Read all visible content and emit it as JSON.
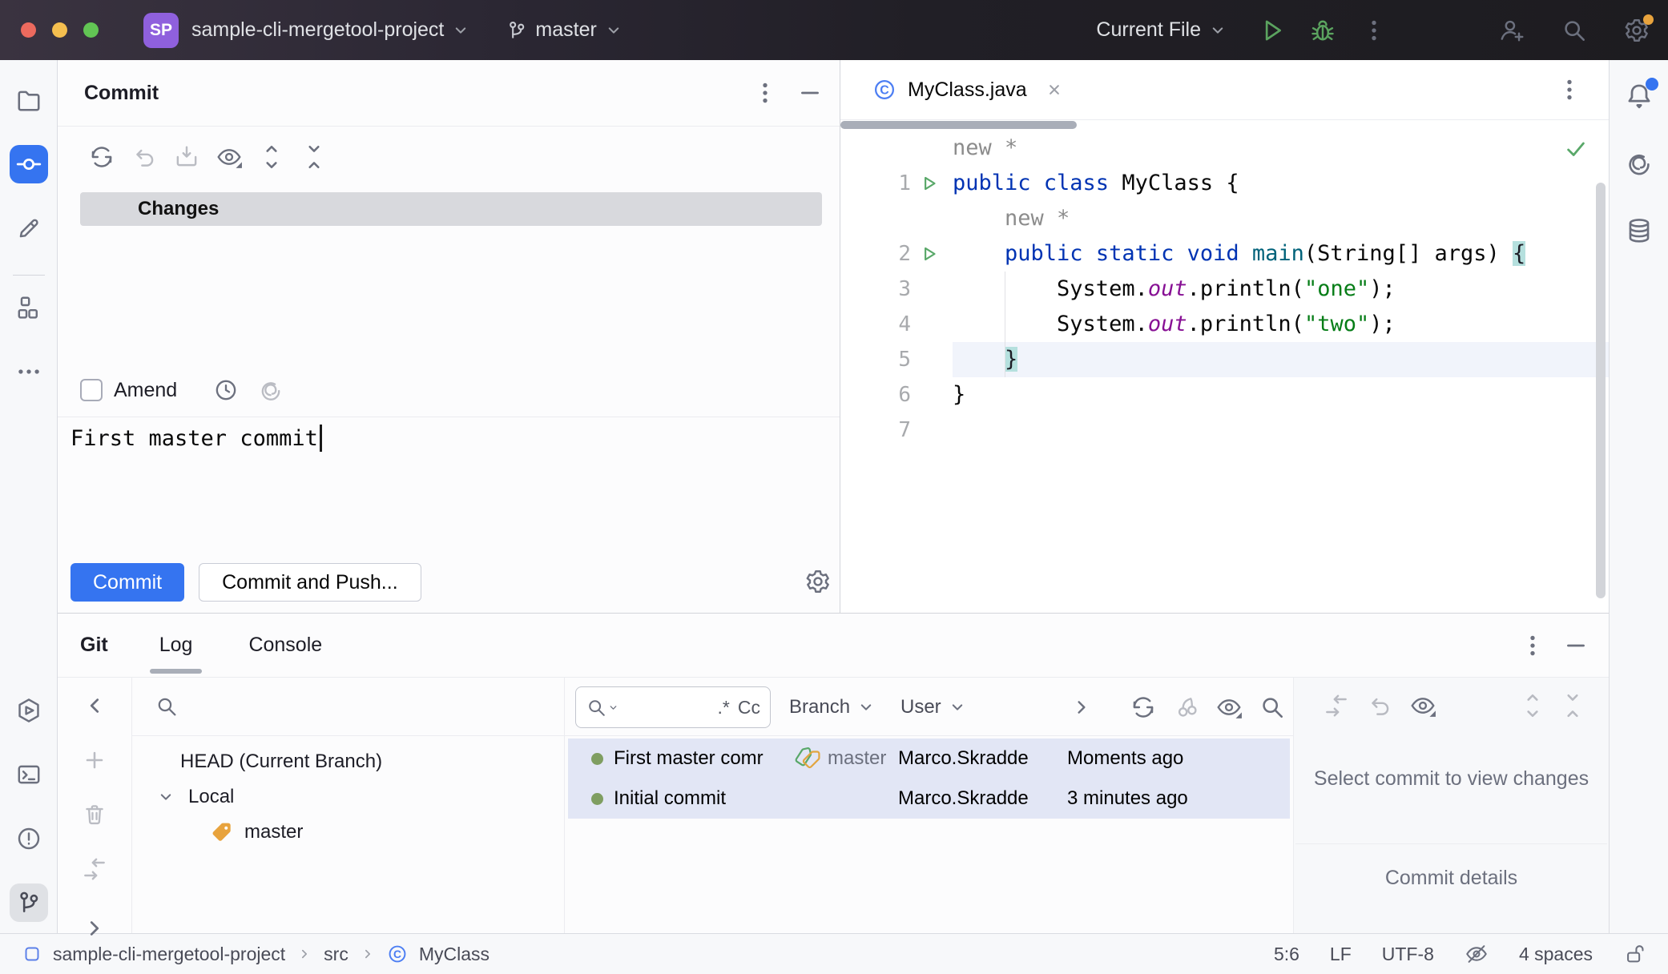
{
  "titlebar": {
    "project_badge": "SP",
    "project_name": "sample-cli-mergetool-project",
    "branch_name": "master",
    "run_config": "Current File"
  },
  "commit": {
    "title": "Commit",
    "changes_label": "Changes",
    "amend_label": "Amend",
    "message": "First master commit",
    "commit_button": "Commit",
    "commit_and_push_button": "Commit and Push..."
  },
  "editor": {
    "tab_title": "MyClass.java",
    "lines": [
      {
        "type": "inlay",
        "indent": 0,
        "text": "new *"
      },
      {
        "type": "code",
        "n": "1",
        "run": true,
        "tokens": [
          [
            "kw",
            "public class"
          ],
          [
            "pl",
            " MyClass {"
          ]
        ]
      },
      {
        "type": "inlay",
        "indent": 4,
        "text": "new *"
      },
      {
        "type": "code",
        "n": "2",
        "run": true,
        "tokens": [
          [
            "pl",
            "    "
          ],
          [
            "kw",
            "public static void"
          ],
          [
            "fn",
            " main"
          ],
          [
            "pl",
            "(String[] args) "
          ],
          [
            "hl",
            "{"
          ]
        ]
      },
      {
        "type": "code",
        "n": "3",
        "tokens": [
          [
            "pl",
            "        System."
          ],
          [
            "fld",
            "out"
          ],
          [
            "pl",
            ".println("
          ],
          [
            "str",
            "\"one\""
          ],
          [
            "pl",
            ");"
          ]
        ]
      },
      {
        "type": "code",
        "n": "4",
        "tokens": [
          [
            "pl",
            "        System."
          ],
          [
            "fld",
            "out"
          ],
          [
            "pl",
            ".println("
          ],
          [
            "str",
            "\"two\""
          ],
          [
            "pl",
            ");"
          ]
        ]
      },
      {
        "type": "code",
        "n": "5",
        "caret": true,
        "tokens": [
          [
            "pl",
            "    "
          ],
          [
            "hl",
            "}"
          ]
        ]
      },
      {
        "type": "code",
        "n": "6",
        "tokens": [
          [
            "pl",
            "}"
          ]
        ]
      },
      {
        "type": "code",
        "n": "7",
        "tokens": []
      }
    ]
  },
  "git": {
    "title": "Git",
    "tabs": [
      {
        "label": "Log",
        "selected": true
      },
      {
        "label": "Console",
        "selected": false
      }
    ],
    "filters": {
      "branch": "Branch",
      "user": "User",
      "regex": ".*",
      "case": "Cc"
    },
    "tree": {
      "head": "HEAD (Current Branch)",
      "local": "Local",
      "branch": "master"
    },
    "rows": [
      {
        "message": "First master comr",
        "tag": "master",
        "author": "Marco.Skradde",
        "date": "Moments ago"
      },
      {
        "message": "Initial commit",
        "tag": "",
        "author": "Marco.Skradde",
        "date": "3 minutes ago"
      }
    ],
    "details_placeholder": "Select commit to view changes",
    "details_header": "Commit details"
  },
  "statusbar": {
    "crumbs": [
      "sample-cli-mergetool-project",
      "src",
      "MyClass"
    ],
    "caret_position": "5:6",
    "line_separator": "LF",
    "encoding": "UTF-8",
    "indent": "4 spaces"
  },
  "icons": {
    "titlebar": [
      "branch-icon",
      "chevron-down-icon",
      "run-icon",
      "debug-icon",
      "kebab-menu-icon",
      "add-user-icon",
      "search-icon",
      "settings-gear-icon"
    ],
    "left_bar": [
      "project-folder-icon",
      "commit-icon",
      "edit-pencil-icon",
      "structure-icon",
      "more-icon",
      "services-icon",
      "terminal-icon",
      "problems-icon",
      "git-branch-icon"
    ],
    "right_bar": [
      "notifications-bell-icon",
      "ai-assistant-icon",
      "database-icon"
    ],
    "commit_toolbar": [
      "refresh-icon",
      "rollback-icon",
      "shelve-icon",
      "eye-icon",
      "expand-all-icon",
      "collapse-all-icon",
      "history-clock-icon",
      "ai-commit-message-icon"
    ],
    "statusbar_icons": [
      "project-square-icon",
      "class-icon",
      "highlighting-off-icon",
      "unlock-icon"
    ]
  },
  "colors": {
    "accent": "#3574F0",
    "tag_orange": "#E8A33D",
    "graph_green": "#7F9E61",
    "row_selection": "#E2E6F5",
    "keyword_blue": "#0033B3",
    "string_green": "#067D17",
    "field_purple": "#871094",
    "method_teal": "#00627A"
  }
}
